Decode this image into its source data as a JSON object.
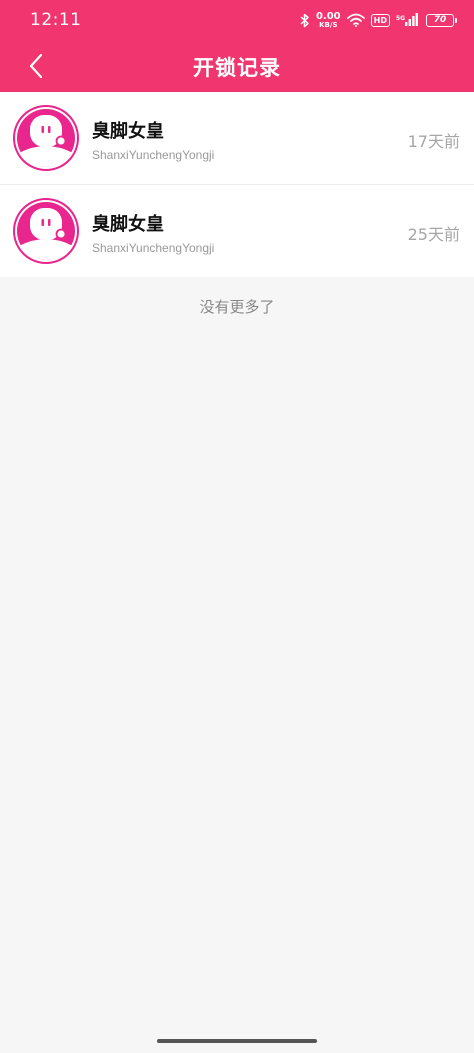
{
  "status_bar": {
    "time": "12:11",
    "net_speed_value": "0.00",
    "net_speed_unit": "KB/S",
    "hd_label": "HD",
    "network_label": "5G",
    "battery_level": "70"
  },
  "header": {
    "title": "开锁记录",
    "background_color": "#f0356f"
  },
  "records": [
    {
      "name": "臭脚女皇",
      "user_id": "ShanxiYunchengYongji",
      "time": "17天前"
    },
    {
      "name": "臭脚女皇",
      "user_id": "ShanxiYunchengYongji",
      "time": "25天前"
    }
  ],
  "footer_text": "没有更多了",
  "accent_color": "#e8268e"
}
